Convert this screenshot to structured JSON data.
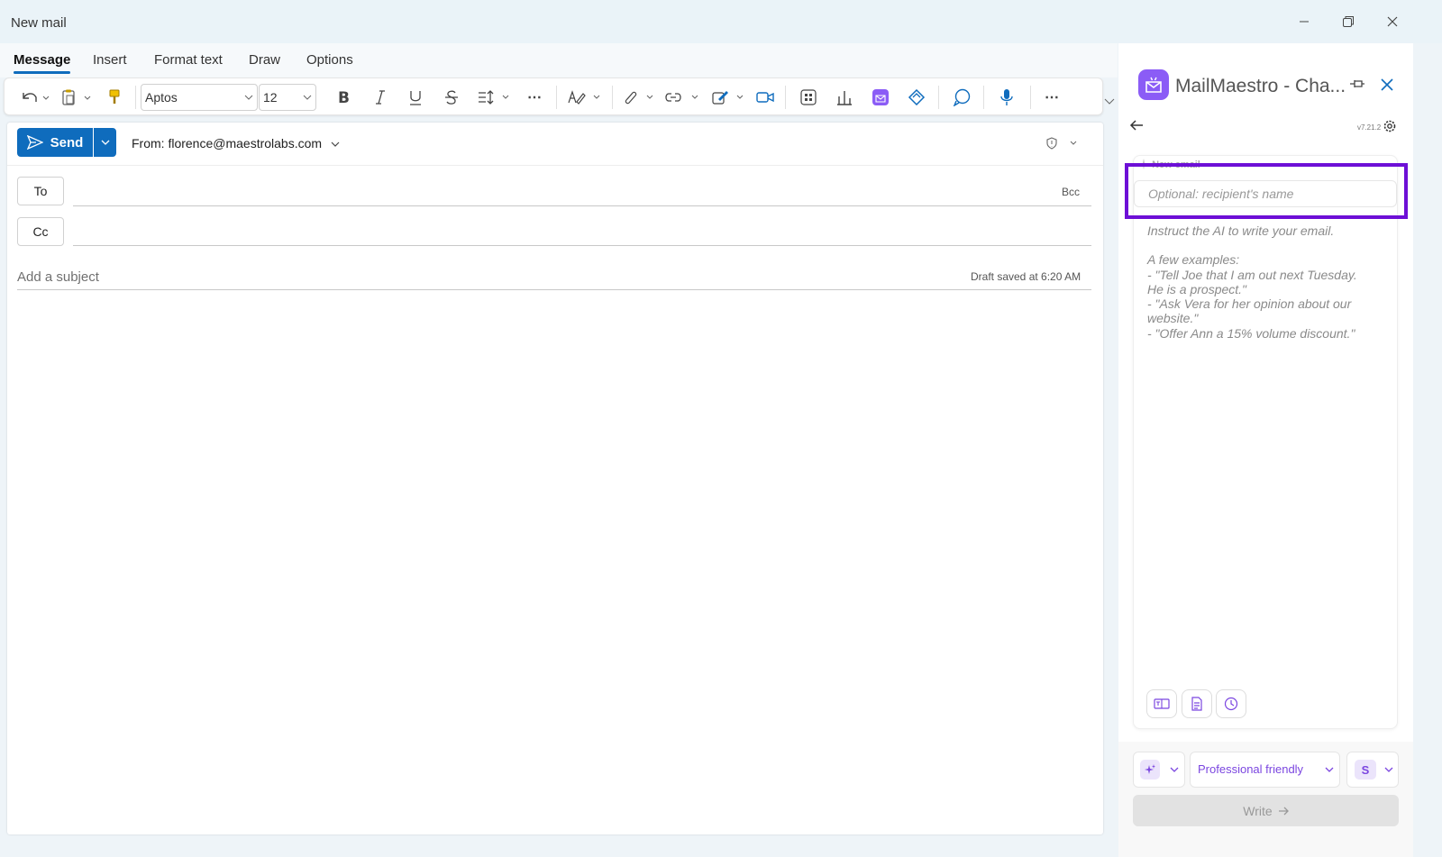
{
  "window": {
    "title": "New mail"
  },
  "tabs": [
    {
      "label": "Message",
      "active": true
    },
    {
      "label": "Insert",
      "active": false
    },
    {
      "label": "Format text",
      "active": false
    },
    {
      "label": "Draw",
      "active": false
    },
    {
      "label": "Options",
      "active": false
    }
  ],
  "ribbon": {
    "font_name": "Aptos",
    "font_size": "12"
  },
  "compose": {
    "send_label": "Send",
    "from_label": "From: florence@maestrolabs.com",
    "to_label": "To",
    "cc_label": "Cc",
    "bcc_label": "Bcc",
    "subject_placeholder": "Add a subject",
    "draft_status": "Draft saved at 6:20 AM"
  },
  "panel": {
    "title": "MailMaestro - Cha...",
    "version": "v7.21.2",
    "section_label": "New email",
    "recipient_placeholder": "Optional: recipient's name",
    "instructions": [
      "Instruct the AI to write your email.",
      "",
      "A few examples:",
      "- \"Tell Joe that I am out next Tuesday.",
      "He is a prospect.\"",
      "- \"Ask Vera for her opinion about our",
      "website.\"",
      "- \"Offer Ann a 15% volume discount.\""
    ],
    "tone": "Professional friendly",
    "length_badge": "S",
    "write_label": "Write",
    "accent_color": "#8b5cf6",
    "highlight_color": "#6d0fd6"
  }
}
